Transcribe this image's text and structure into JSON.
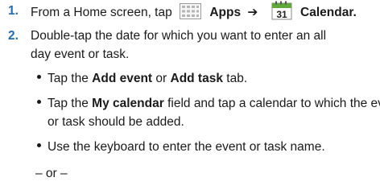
{
  "steps": [
    {
      "number": "1.",
      "prefix": "From a Home screen, tap",
      "apps_label": "Apps",
      "arrow": "➔",
      "calendar_icon_day": "31",
      "calendar_label": "Calendar."
    },
    {
      "number": "2.",
      "line1": "Double-tap the date for which you want to enter an all",
      "line2": "day event or task."
    }
  ],
  "bullets": [
    {
      "pre": "Tap the ",
      "b1": "Add event",
      "mid": " or ",
      "b2": "Add task",
      "post": " tab."
    },
    {
      "pre": "Tap the ",
      "b1": "My calendar",
      "post": " field and tap a calendar to which the even",
      "line2": "or task should be added."
    },
    {
      "text": "Use the keyboard to enter the event or task name."
    }
  ],
  "or_separator": "– or –",
  "icons": {
    "apps": "apps-grid-icon",
    "calendar": "calendar-icon"
  },
  "colors": {
    "step_number": "#1e6db3",
    "text": "#1a1a1a",
    "calendar_icon_top": "#5fa83a"
  }
}
